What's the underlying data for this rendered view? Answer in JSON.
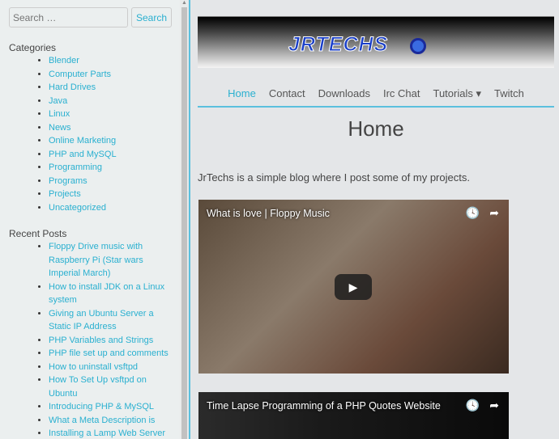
{
  "sidebar": {
    "search_placeholder": "Search …",
    "search_button": "Search",
    "categories_title": "Categories",
    "categories": [
      "Blender",
      "Computer Parts",
      "Hard Drives",
      "Java",
      "Linux",
      "News",
      "Online Marketing",
      "PHP and MySQL",
      "Programming",
      "Programs",
      "Projects",
      "Uncategorized"
    ],
    "recent_title": "Recent Posts",
    "recent": [
      "Floppy Drive music with Raspberry Pi (Star wars Imperial March)",
      "How to install JDK on a Linux system",
      "Giving an Ubuntu Server a Static IP Address",
      "PHP Variables and Strings",
      "PHP file set up and comments",
      "How to uninstall vsftpd",
      "How To Set Up vsftpd on Ubuntu",
      "Introducing PHP & MySQL",
      "What a Meta Description is",
      "Installing a Lamp Web Server"
    ]
  },
  "header": {
    "logo": "JRTECHS"
  },
  "nav": {
    "items": [
      "Home",
      "Contact",
      "Downloads",
      "Irc Chat",
      "Tutorials",
      "Twitch"
    ],
    "active": "Home"
  },
  "main": {
    "title": "Home",
    "intro": "JrTechs is a simple blog where I post some of my projects.",
    "videos": [
      {
        "title": "What is love | Floppy Music"
      },
      {
        "title": "Time Lapse Programming of a PHP Quotes Website"
      }
    ]
  }
}
